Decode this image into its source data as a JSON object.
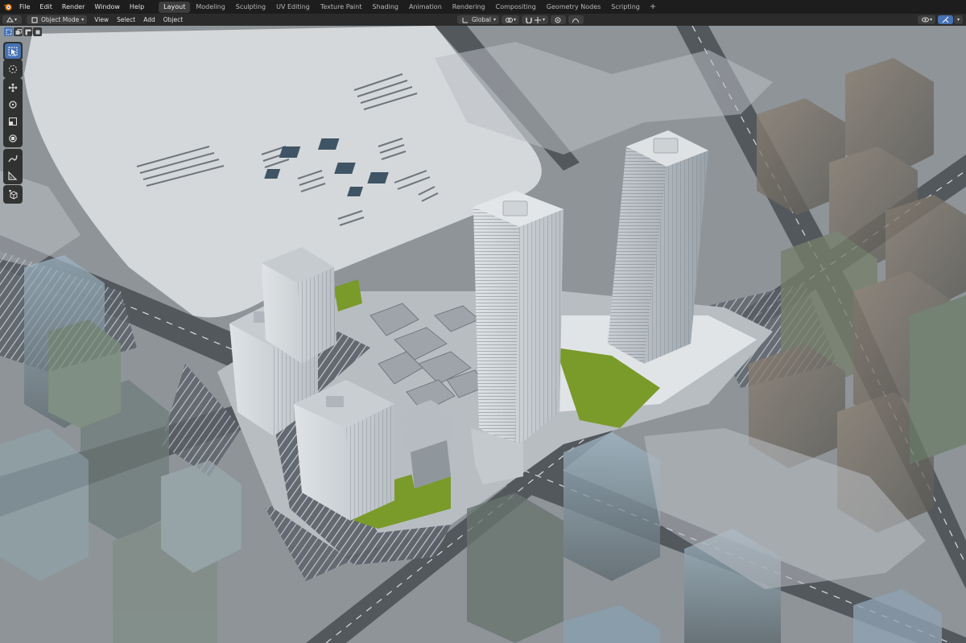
{
  "menu": {
    "file": "File",
    "edit": "Edit",
    "render": "Render",
    "window": "Window",
    "help": "Help"
  },
  "workspaces": [
    {
      "label": "Layout",
      "active": true
    },
    {
      "label": "Modeling",
      "active": false
    },
    {
      "label": "Sculpting",
      "active": false
    },
    {
      "label": "UV Editing",
      "active": false
    },
    {
      "label": "Texture Paint",
      "active": false
    },
    {
      "label": "Shading",
      "active": false
    },
    {
      "label": "Animation",
      "active": false
    },
    {
      "label": "Rendering",
      "active": false
    },
    {
      "label": "Compositing",
      "active": false
    },
    {
      "label": "Geometry Nodes",
      "active": false
    },
    {
      "label": "Scripting",
      "active": false
    }
  ],
  "workspace_add": "+",
  "header": {
    "mode": "Object Mode",
    "view": "View",
    "select": "Select",
    "add": "Add",
    "object": "Object",
    "transform_orientation": "Global"
  },
  "icons": {
    "app": "blender-logo-icon",
    "editor_type": "3d-viewport-icon",
    "mode": "object-mode-icon",
    "tools": [
      "select-box-icon",
      "cursor-icon",
      "move-icon",
      "rotate-icon",
      "scale-icon",
      "transform-icon",
      "annotate-icon",
      "measure-icon",
      "add-cube-icon"
    ]
  },
  "colors": {
    "topbar": "#1d1d1d",
    "header": "#2b2b2b",
    "accent": "#4772b3",
    "ground": "#8c9296",
    "plaza": "#d4d7da",
    "green_roof": "#7a9a2a"
  }
}
